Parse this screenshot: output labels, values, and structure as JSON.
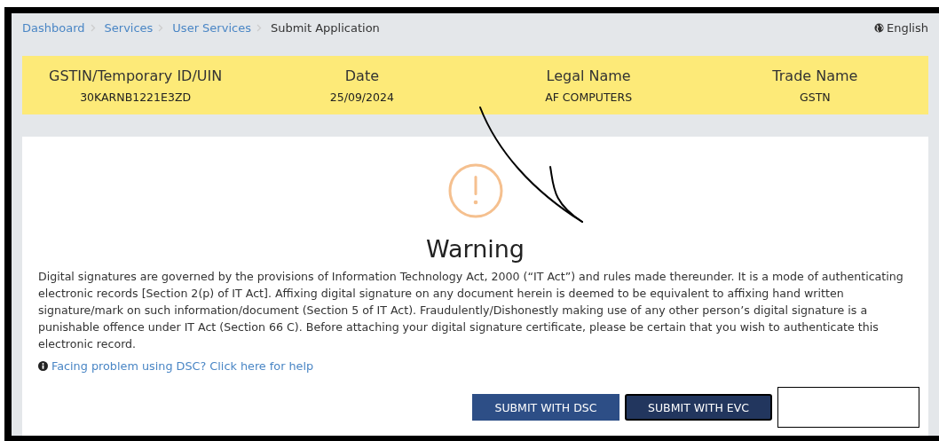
{
  "breadcrumb": [
    {
      "label": "Dashboard",
      "kind": "link"
    },
    {
      "label": "Services",
      "kind": "link"
    },
    {
      "label": "User Services",
      "kind": "link"
    },
    {
      "label": "Submit Application",
      "kind": "current"
    }
  ],
  "language": "English",
  "taxpayer": [
    {
      "heading": "GSTIN/Temporary ID/UIN",
      "value": "30KARNB1221E3ZD"
    },
    {
      "heading": "Date",
      "value": "25/09/2024"
    },
    {
      "heading": "Legal Name",
      "value": "AF COMPUTERS"
    },
    {
      "heading": "Trade Name",
      "value": "GSTN"
    }
  ],
  "warning": {
    "title": "Warning",
    "text": "Digital signatures are governed by the provisions of Information Technology Act, 2000 (“IT Act”) and rules made thereunder. It is a mode of authenticating electronic records [Section 2(p) of IT Act]. Affixing digital signature on any document herein is deemed to be equivalent to affixing hand written signature/mark on such information/document (Section 5 of IT Act). Fraudulently/Dishonestly making use of any other person’s digital signature is a punishable offence under IT Act (Section 66 C). Before attaching your digital signature certificate, please be certain that you wish to authenticate this electronic record.",
    "help_link": "Facing problem using DSC? Click here for help"
  },
  "buttons": [
    {
      "label": "SUBMIT WITH DSC",
      "selected": false
    },
    {
      "label": "SUBMIT WITH EVC",
      "selected": true
    }
  ]
}
